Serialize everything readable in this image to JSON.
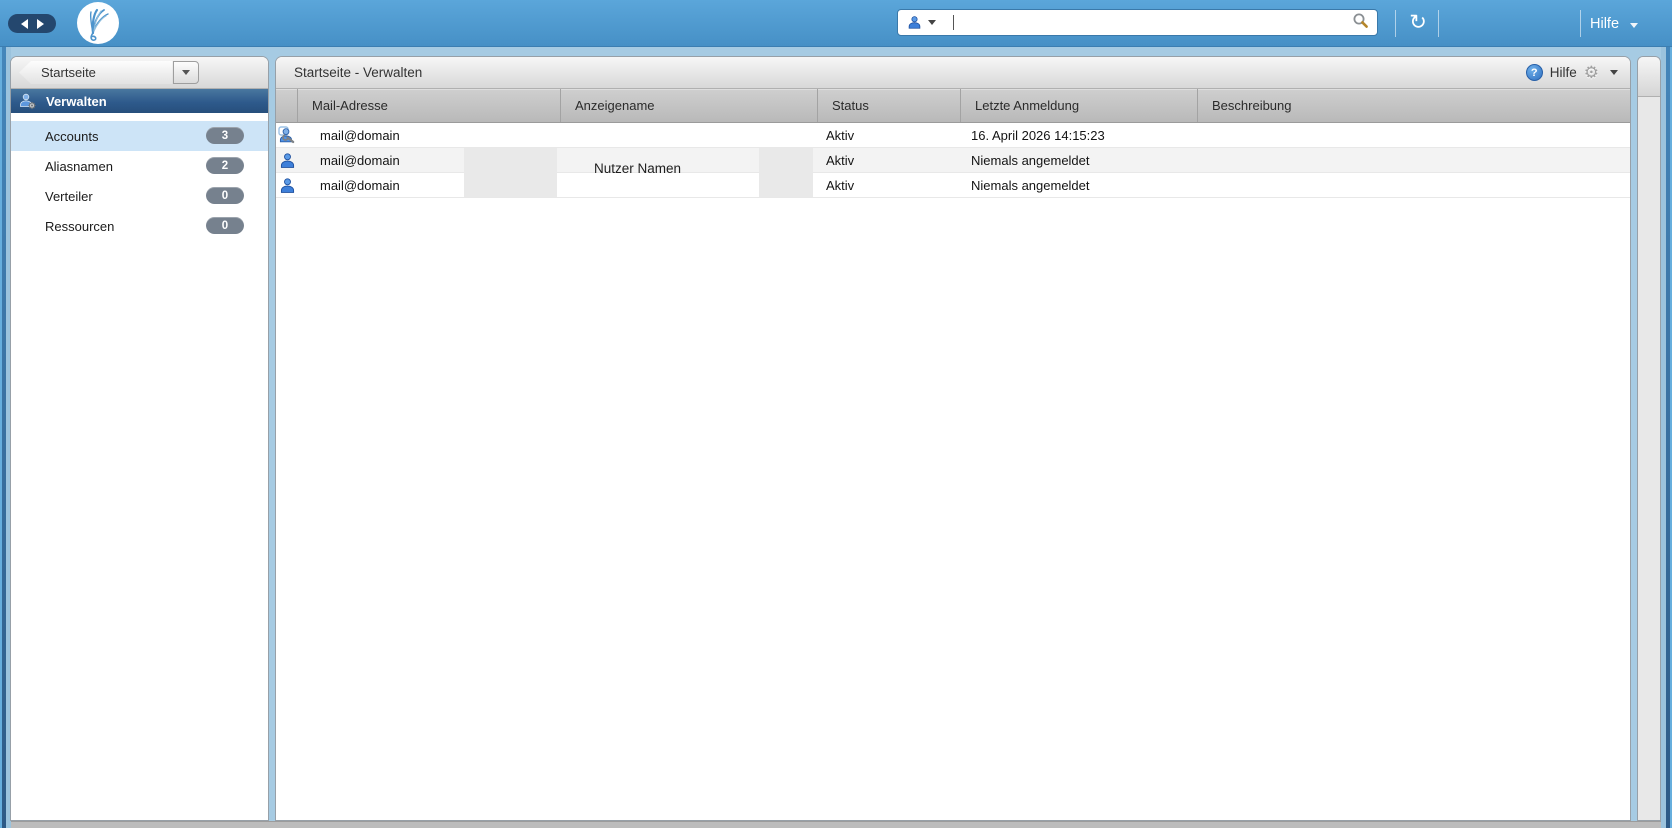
{
  "topbar": {
    "search": {
      "value": "",
      "placeholder": ""
    },
    "help_label": "Hilfe"
  },
  "sidebar": {
    "breadcrumb_label": "Startseite",
    "section_label": "Verwalten",
    "items": [
      {
        "label": "Accounts",
        "count": "3"
      },
      {
        "label": "Aliasnamen",
        "count": "2"
      },
      {
        "label": "Verteiler",
        "count": "0"
      },
      {
        "label": "Ressourcen",
        "count": "0"
      }
    ]
  },
  "main": {
    "title": "Startseite - Verwalten",
    "help_label": "Hilfe",
    "table": {
      "columns": [
        "Mail-Adresse",
        "Anzeigename",
        "Status",
        "Letzte Anmeldung",
        "Beschreibung"
      ],
      "rows": [
        {
          "icon": "admin-user-icon",
          "mail": "mail@domain",
          "anzeigename": "",
          "status": "Aktiv",
          "letzte_anmeldung": "16. April 2026 14:15:23",
          "beschreibung": ""
        },
        {
          "icon": "user-icon",
          "mail": "mail@domain",
          "anzeigename": "",
          "status": "Aktiv",
          "letzte_anmeldung": "Niemals angemeldet",
          "beschreibung": ""
        },
        {
          "icon": "user-icon",
          "mail": "mail@domain",
          "anzeigename": "",
          "status": "Aktiv",
          "letzte_anmeldung": "Niemals angemeldet",
          "beschreibung": ""
        }
      ],
      "anzeigename_overlay": "Nutzer Namen"
    }
  },
  "colors": {
    "topbar_blue": "#4f9bd1",
    "background_blue": "#a6cbe3",
    "section_bar_blue": "#2e5a8c",
    "selected_item_blue": "#cde4f7",
    "badge_gray": "#76818e",
    "header_gray": "#e3e3e3",
    "grid_header_gray": "#bfbfbf"
  }
}
